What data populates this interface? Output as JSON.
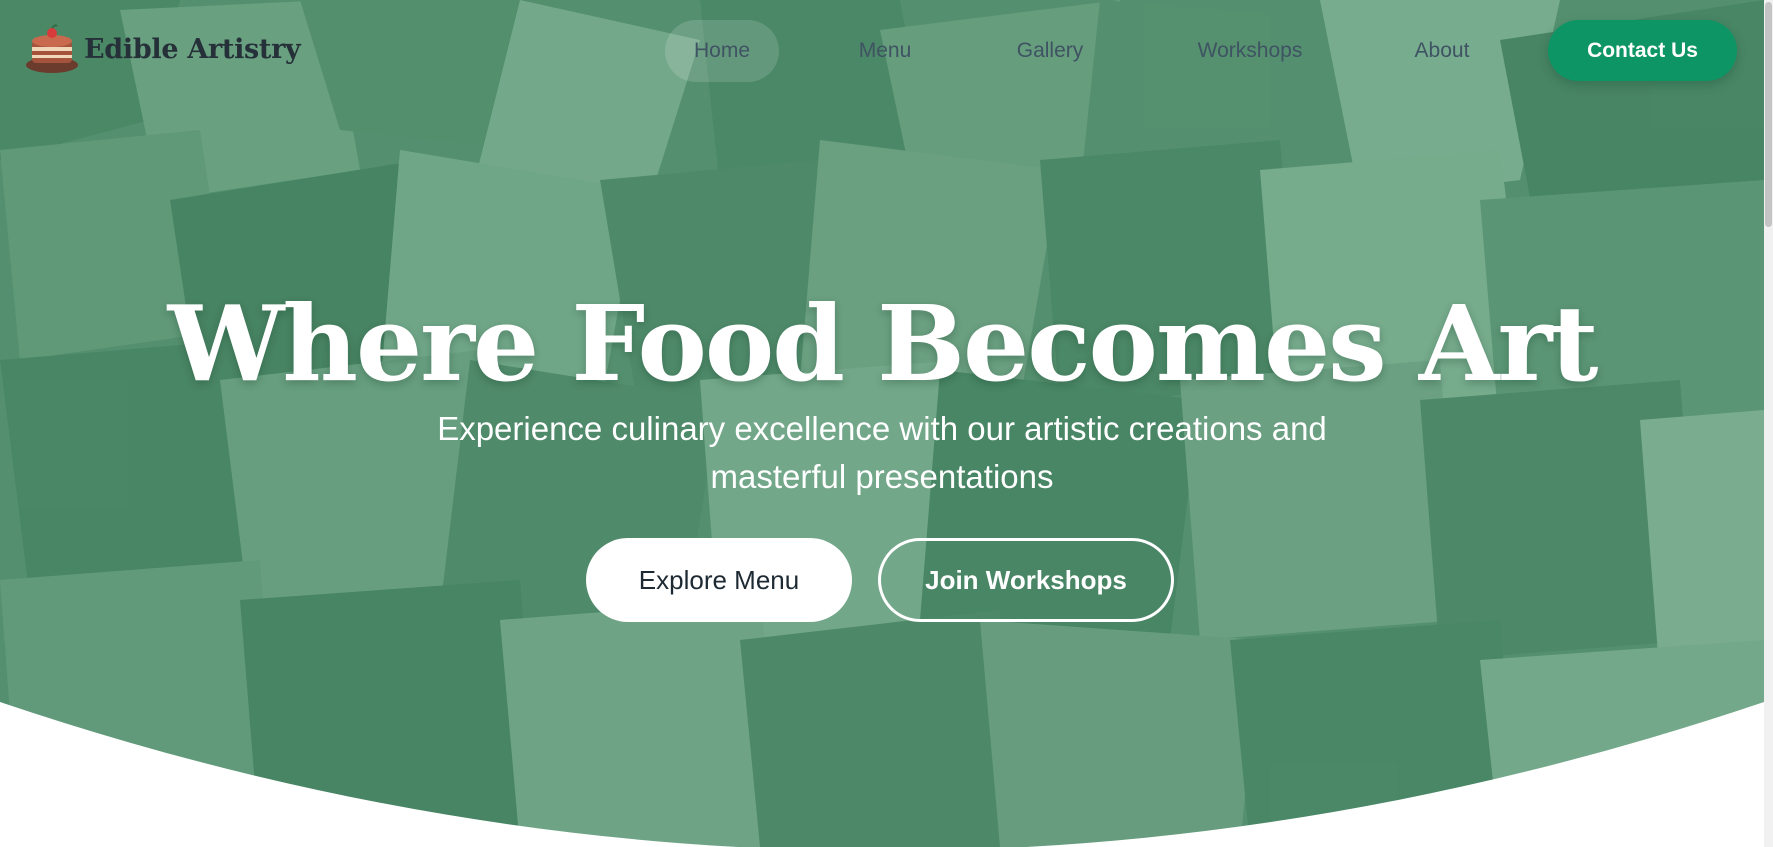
{
  "brand": {
    "name": "Edible Artistry",
    "logo_icon": "cake-logo-icon"
  },
  "nav": {
    "items": [
      {
        "label": "Home",
        "active": true
      },
      {
        "label": "Menu"
      },
      {
        "label": "Gallery"
      },
      {
        "label": "Workshops"
      },
      {
        "label": "About"
      }
    ],
    "cta_label": "Contact Us"
  },
  "hero": {
    "title": "Where Food Becomes Art",
    "subtitle": "Experience culinary excellence with our artistic creations and masterful presentations",
    "primary_button": "Explore Menu",
    "secondary_button": "Join Workshops",
    "background": "green tissue paper squares"
  },
  "colors": {
    "accent": "#0e9566",
    "hero_green": "#5f9a79",
    "nav_text": "#3f5363",
    "brand_text": "#253038"
  }
}
